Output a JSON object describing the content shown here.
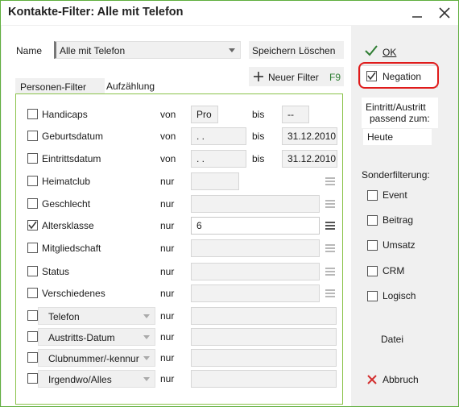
{
  "window": {
    "title": "Kontakte-Filter: Alle mit Telefon"
  },
  "name_row": {
    "label": "Name",
    "value": "Alle mit Telefon",
    "save": "Speichern",
    "delete": "Löschen"
  },
  "tabs": {
    "persons": "Personen-Filter",
    "enum": "Aufzählung"
  },
  "new_filter": {
    "label": "Neuer Filter",
    "shortcut": "F9"
  },
  "rows": [
    {
      "label": "Handicaps",
      "checked": false,
      "op": "von",
      "value": "Pro",
      "op2": "bis",
      "value2": "--"
    },
    {
      "label": "Geburtsdatum",
      "checked": false,
      "op": "von",
      "value": " .  .",
      "op2": "bis",
      "value2": "31.12.2010"
    },
    {
      "label": "Eintrittsdatum",
      "checked": false,
      "op": "von",
      "value": " .  .",
      "op2": "bis",
      "value2": "31.12.2010"
    },
    {
      "label": "Heimatclub",
      "checked": false,
      "op": "nur",
      "value": ""
    },
    {
      "label": "Geschlecht",
      "checked": false,
      "op": "nur",
      "value": ""
    },
    {
      "label": "Altersklasse",
      "checked": true,
      "op": "nur",
      "value": "6"
    },
    {
      "label": "Mitgliedschaft",
      "checked": false,
      "op": "nur",
      "value": ""
    },
    {
      "label": "Status",
      "checked": false,
      "op": "nur",
      "value": ""
    },
    {
      "label": "Verschiedenes",
      "checked": false,
      "op": "nur",
      "value": ""
    },
    {
      "label": "Telefon",
      "checked": false,
      "op": "nur",
      "value": "",
      "combo": true
    },
    {
      "label": "Austritts-Datum",
      "checked": false,
      "op": "nur",
      "value": "",
      "combo": true
    },
    {
      "label": "Clubnummer/-kennur",
      "checked": false,
      "op": "nur",
      "value": "",
      "combo": true
    },
    {
      "label": "Irgendwo/Alles",
      "checked": false,
      "op": "nur",
      "value": "",
      "combo": true
    }
  ],
  "side": {
    "ok": "OK",
    "negation": "Negation",
    "eintritt_label_1": "Eintritt/Austritt",
    "eintritt_label_2": "passend zum:",
    "eintritt_value": "Heute",
    "sonder_label": "Sonderfilterung:",
    "options": [
      "Event",
      "Beitrag",
      "Umsatz",
      "CRM",
      "Logisch"
    ],
    "datei": "Datei",
    "abbruch": "Abbruch"
  },
  "colors": {
    "accent_green": "#5fae3e",
    "highlight_red": "#e01b1b",
    "checkmark": "#2e7d32"
  }
}
